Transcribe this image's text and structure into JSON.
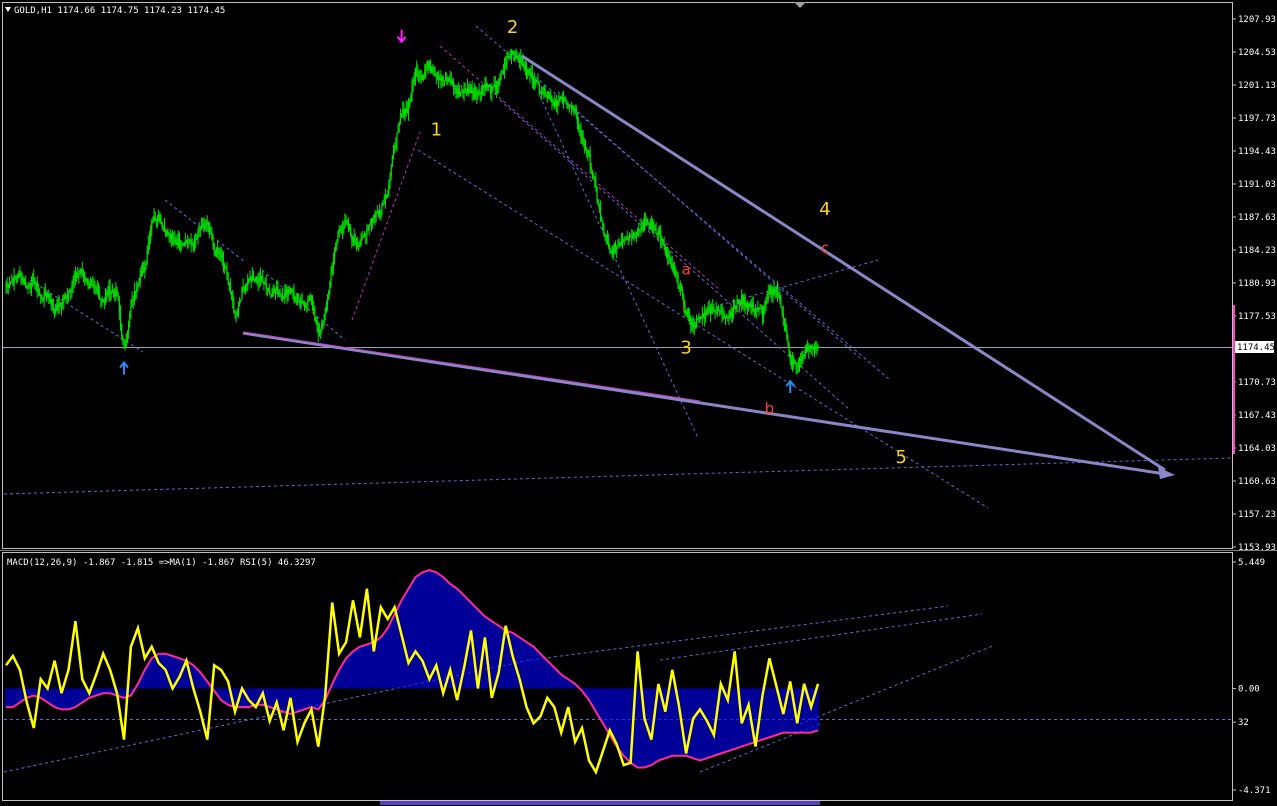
{
  "header": {
    "main": "GOLD,H1  1174.66  1174.75  1174.23  1174.45",
    "indicator": "MACD(12,26,9) -1.867 -1.815  =>MA(1) -1.867  RSI(5) 46.3297"
  },
  "colors": {
    "background": "#000000",
    "grid_frame": "#c0c0c0",
    "candle": "#00e000",
    "wave_yellow": "#ffd21e",
    "wave_red": "#ff4020",
    "trend_line": "#8a87c8",
    "dashed_line": "#5a6ad8",
    "histogram": "#0000ff",
    "signal_line": "#ff2a9a",
    "rsi_line": "#ffff00",
    "arrow_up": "#1e8fff",
    "arrow_down": "#ff20ff"
  },
  "current_price_label": "1174.45",
  "chart_data": [
    {
      "type": "candlestick",
      "symbol": "GOLD",
      "timeframe": "H1",
      "y_ticks": [
        "1207.93",
        "1204.53",
        "1201.13",
        "1197.73",
        "1194.43",
        "1191.03",
        "1187.63",
        "1184.23",
        "1180.93",
        "1177.53",
        "1174.45",
        "1170.73",
        "1167.43",
        "1164.03",
        "1160.63",
        "1157.23",
        "1153.93"
      ],
      "ylim": [
        1153.93,
        1207.93
      ],
      "close_path": [
        1180.7,
        1181.2,
        1181.8,
        1180.6,
        1181.2,
        1179.4,
        1179.8,
        1178.2,
        1178.8,
        1180.1,
        1181.5,
        1182.2,
        1180.6,
        1180.1,
        1179.2,
        1180.3,
        1179.7,
        1173.9,
        1178.4,
        1181.2,
        1182.6,
        1187.4,
        1187.8,
        1186.2,
        1185.3,
        1185.1,
        1185.2,
        1184.7,
        1186.4,
        1186.9,
        1184.3,
        1183.6,
        1181.4,
        1177.6,
        1180.1,
        1181.4,
        1181.2,
        1181.4,
        1179.9,
        1180.2,
        1179.7,
        1180.5,
        1178.6,
        1178.9,
        1179.3,
        1175.5,
        1177.9,
        1182.6,
        1186.4,
        1187.1,
        1185.3,
        1184.9,
        1186.4,
        1187.8,
        1188.5,
        1190.4,
        1194.9,
        1198.2,
        1198.9,
        1202.7,
        1202.1,
        1203.4,
        1202.3,
        1201.6,
        1201.7,
        1200.3,
        1200.6,
        1200.8,
        1200.4,
        1201.2,
        1200.6,
        1201.4,
        1203.5,
        1204.7,
        1203.9,
        1202.6,
        1201.9,
        1200.7,
        1200.3,
        1199.4,
        1199.6,
        1199.3,
        1198.3,
        1195.6,
        1193.8,
        1190.4,
        1186.3,
        1184.1,
        1184.7,
        1185.6,
        1185.8,
        1186.2,
        1187.1,
        1186.8,
        1186.2,
        1184.1,
        1182.4,
        1180.7,
        1177.8,
        1176.6,
        1177.3,
        1178.1,
        1178.4,
        1177.9,
        1177.6,
        1178.4,
        1179.2,
        1178.7,
        1178.3,
        1177.9,
        1179.8,
        1180.5,
        1177.6,
        1172.9,
        1172.4,
        1173.8,
        1174.4,
        1174.5
      ],
      "wave_labels": [
        {
          "text": "1",
          "kind": "primary",
          "price": 1196.0,
          "bar": 62
        },
        {
          "text": "2",
          "kind": "primary",
          "price": 1206.5,
          "bar": 73
        },
        {
          "text": "3",
          "kind": "primary",
          "price": 1173.7,
          "bar": 98
        },
        {
          "text": "4",
          "kind": "primary",
          "price": 1187.9,
          "bar": 118
        },
        {
          "text": "5",
          "kind": "primary",
          "price": 1162.5,
          "bar": 129
        },
        {
          "text": "a",
          "kind": "secondary",
          "price": 1181.8,
          "bar": 98
        },
        {
          "text": "b",
          "kind": "secondary",
          "price": 1167.6,
          "bar": 110
        },
        {
          "text": "c",
          "kind": "secondary",
          "price": 1184.0,
          "bar": 118
        }
      ],
      "fractal_arrows": [
        {
          "dir": "up",
          "price": 1173.0
        },
        {
          "dir": "down",
          "price": 1205.4
        },
        {
          "dir": "up",
          "price": 1171.1
        }
      ]
    },
    {
      "type": "line",
      "name": "MACD / RSI",
      "y_ticks": [
        "5.449",
        "0.00",
        "32",
        "-4.371"
      ],
      "ylim": [
        -4.371,
        5.449
      ],
      "histogram": [
        -0.8,
        -0.8,
        -0.6,
        -0.4,
        -0.3,
        -0.4,
        -0.6,
        -0.8,
        -0.9,
        -0.9,
        -0.8,
        -0.6,
        -0.4,
        -0.3,
        -0.2,
        -0.2,
        -0.3,
        -0.4,
        -0.3,
        0.2,
        0.8,
        1.3,
        1.5,
        1.5,
        1.4,
        1.3,
        1.2,
        1.0,
        0.7,
        0.3,
        -0.1,
        -0.5,
        -0.7,
        -0.8,
        -0.8,
        -0.8,
        -0.7,
        -0.7,
        -0.8,
        -0.9,
        -1.0,
        -1.1,
        -1.0,
        -0.9,
        -0.8,
        -0.9,
        -0.5,
        0.2,
        0.8,
        1.3,
        1.6,
        1.8,
        1.9,
        2.0,
        2.2,
        2.6,
        3.2,
        3.8,
        4.3,
        4.8,
        5.0,
        5.1,
        5.0,
        4.8,
        4.5,
        4.3,
        4.0,
        3.7,
        3.4,
        3.1,
        2.9,
        2.7,
        2.5,
        2.4,
        2.2,
        2.0,
        1.8,
        1.5,
        1.2,
        0.9,
        0.6,
        0.4,
        0.2,
        -0.1,
        -0.5,
        -1.0,
        -1.5,
        -2.0,
        -2.5,
        -2.9,
        -3.2,
        -3.4,
        -3.4,
        -3.3,
        -3.1,
        -3.0,
        -2.9,
        -2.9,
        -2.9,
        -3.0,
        -3.1,
        -3.0,
        -2.9,
        -2.8,
        -2.7,
        -2.6,
        -2.5,
        -2.4,
        -2.3,
        -2.2,
        -2.1,
        -2.0,
        -1.9,
        -1.9,
        -1.9,
        -1.9,
        -1.9,
        -1.8
      ],
      "rsi_scaled": [
        1.0,
        1.4,
        0.8,
        -0.6,
        -1.7,
        0.4,
        0.0,
        1.2,
        -0.2,
        0.8,
        2.9,
        0.4,
        -0.2,
        0.6,
        1.5,
        0.8,
        -0.2,
        -2.2,
        1.8,
        2.6,
        1.3,
        1.8,
        1.1,
        0.8,
        0.0,
        0.5,
        1.2,
        0.0,
        -1.0,
        -2.2,
        1.0,
        0.8,
        0.3,
        -1.0,
        0.0,
        -0.5,
        -0.8,
        -0.2,
        -1.4,
        -0.6,
        -1.8,
        -0.4,
        -2.3,
        -1.5,
        -0.9,
        -2.5,
        -0.3,
        3.7,
        1.5,
        2.0,
        3.8,
        2.2,
        4.3,
        1.6,
        3.5,
        3.0,
        3.5,
        2.3,
        1.1,
        1.6,
        1.2,
        0.4,
        1.0,
        -0.2,
        0.8,
        -0.5,
        0.9,
        2.5,
        0.0,
        2.2,
        -0.4,
        0.7,
        2.7,
        1.4,
        0.4,
        -0.8,
        -1.5,
        -1.2,
        -0.4,
        -0.8,
        -1.9,
        -0.8,
        -2.3,
        -1.7,
        -3.1,
        -3.6,
        -2.7,
        -1.8,
        -2.4,
        -3.3,
        -3.2,
        1.6,
        -1.3,
        -2.2,
        0.2,
        -1.0,
        0.8,
        -0.8,
        -2.8,
        -1.3,
        -0.9,
        -1.4,
        -2.0,
        0.2,
        -0.5,
        1.6,
        -1.5,
        -0.7,
        -2.5,
        -0.3,
        1.3,
        0.1,
        -1.1,
        0.3,
        -1.5,
        0.2,
        -0.8,
        0.2
      ]
    }
  ]
}
